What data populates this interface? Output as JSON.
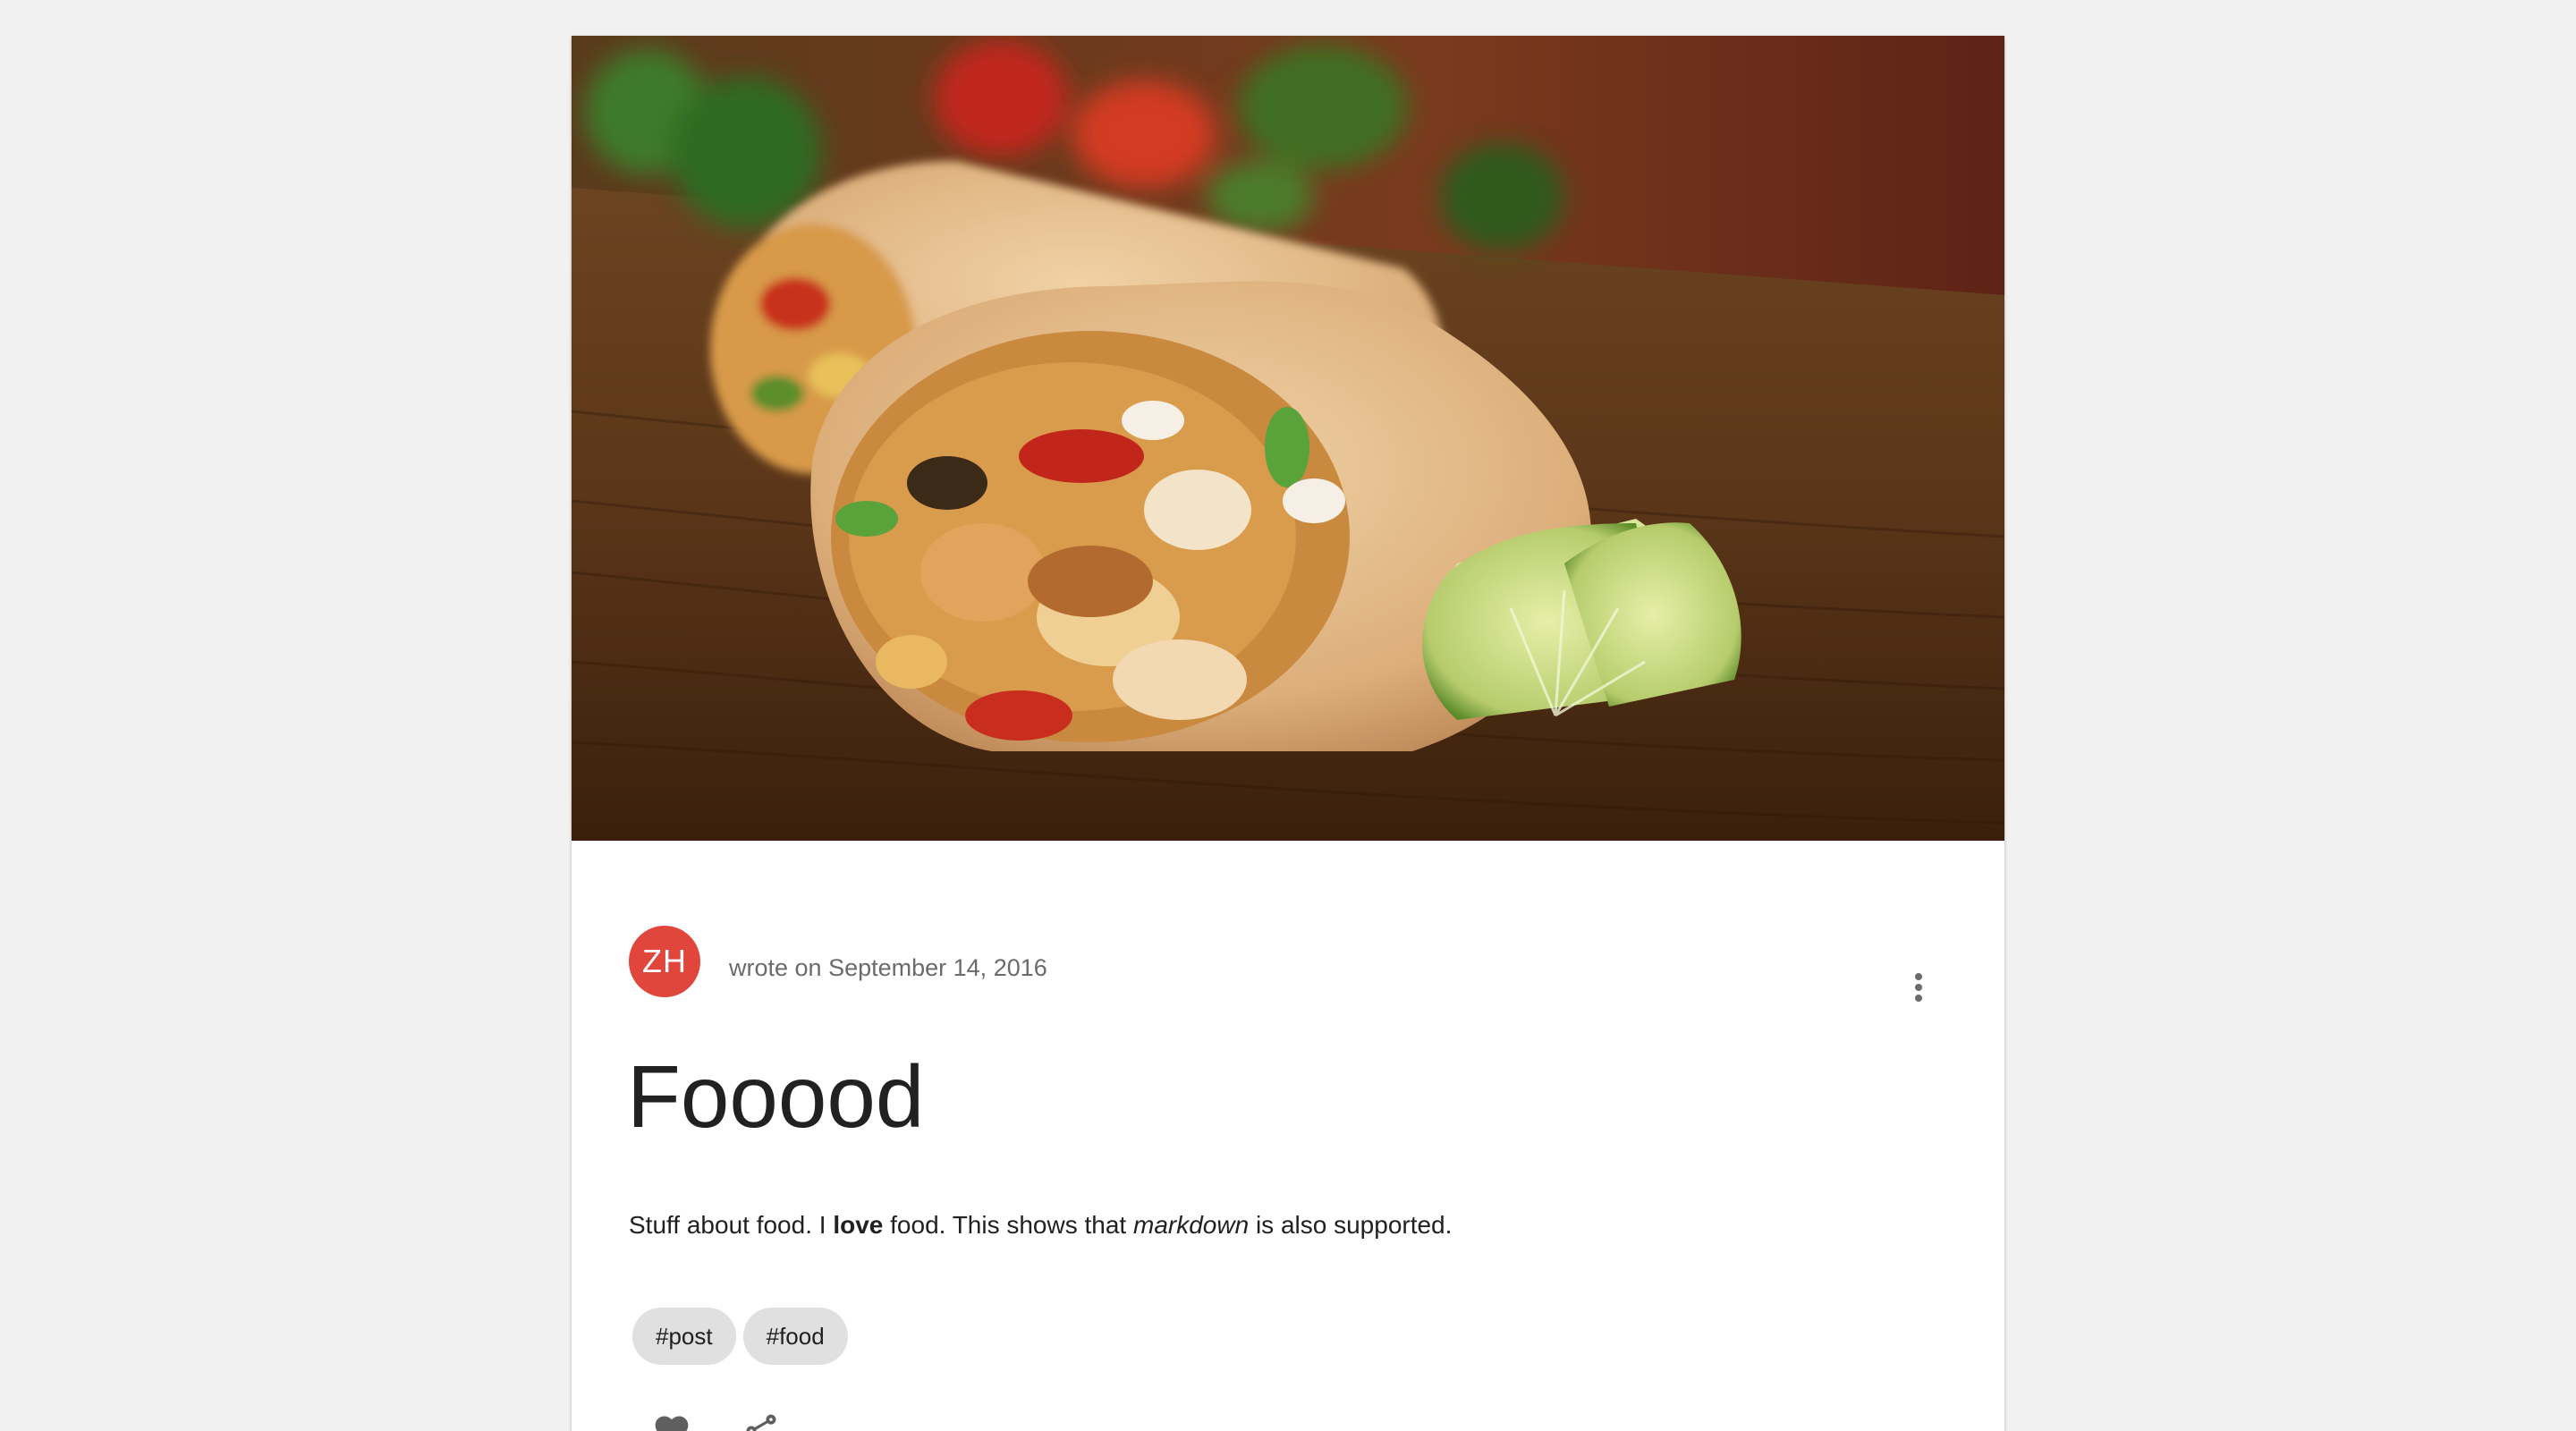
{
  "post": {
    "avatar_initials": "ZH",
    "byline_prefix": "wrote on",
    "date": "September 14, 2016",
    "title": "Fooood",
    "body": {
      "part1": "Stuff about food. I ",
      "bold": "love",
      "part2": " food. This shows that ",
      "italic": "markdown",
      "part3": " is also supported."
    },
    "tags": [
      "#post",
      "#food"
    ],
    "hero_image": "burrito-photo"
  },
  "icons": {
    "more": "more-vert-icon",
    "like": "heart-icon",
    "share": "share-icon"
  },
  "colors": {
    "avatar": "#e0463b",
    "page_background": "#f1f1f1",
    "card": "#ffffff",
    "tag_chip": "#e0e0e0"
  }
}
